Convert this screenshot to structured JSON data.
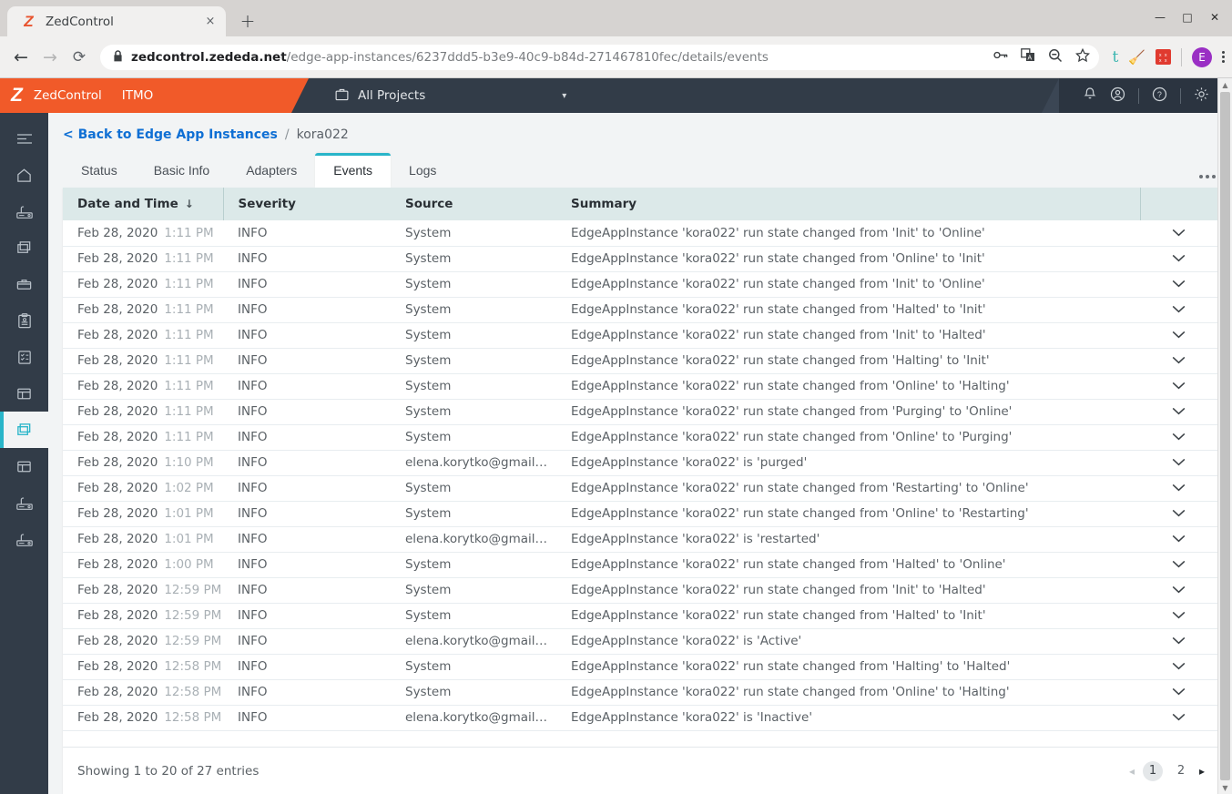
{
  "browser": {
    "tab": {
      "title": "ZedControl",
      "favicon": "zedcontrol-z-icon",
      "close_label": "×"
    },
    "new_tab_label": "+",
    "window_controls": {
      "minimize": "—",
      "maximize": "□",
      "close": "✕"
    },
    "nav": {
      "back": "←",
      "forward": "→",
      "reload": "⟳"
    },
    "url": {
      "lock": "🔒",
      "host": "zedcontrol.zededa.net",
      "path": "/edge-app-instances/6237ddd5-b3e9-40c9-b84d-271467810fec/details/events"
    },
    "omnibox_icons": [
      "key-icon",
      "translate-icon",
      "zoom-out-icon",
      "bookmark-star-icon"
    ],
    "extensions": [
      "tumblr-extension-icon",
      "broom-extension-icon",
      "adblock-extension-icon"
    ],
    "profile_initial": "E",
    "menu": "chrome-menu-icon"
  },
  "appbar": {
    "logo": "Z",
    "product": "ZedControl",
    "org": "ITMO",
    "project_selector": {
      "icon": "briefcase-icon",
      "label": "All Projects",
      "caret": "▾"
    },
    "actions": [
      "notifications-bell-icon",
      "user-account-icon",
      "help-icon",
      "settings-gear-icon"
    ]
  },
  "sidebar": {
    "items": [
      {
        "name": "menu-toggle",
        "icon": "hamburger-icon",
        "active": false
      },
      {
        "name": "home",
        "icon": "home-icon",
        "active": false
      },
      {
        "name": "edge-nodes",
        "icon": "router-icon",
        "active": false
      },
      {
        "name": "edge-apps",
        "icon": "app-stack-icon",
        "active": false
      },
      {
        "name": "volumes",
        "icon": "archive-box-icon",
        "active": false
      },
      {
        "name": "jobs",
        "icon": "clipboard-icon",
        "active": false
      },
      {
        "name": "policies",
        "icon": "checklist-icon",
        "active": false
      },
      {
        "name": "projects",
        "icon": "layout-panel-icon",
        "active": false
      },
      {
        "name": "edge-app-instances",
        "icon": "app-instance-icon",
        "active": true
      },
      {
        "name": "network-instances",
        "icon": "layout-panel-icon",
        "active": false
      },
      {
        "name": "device-models",
        "icon": "router-icon",
        "active": false
      },
      {
        "name": "device-configs",
        "icon": "router-icon",
        "active": false
      }
    ]
  },
  "breadcrumb": {
    "back_label": "< Back to Edge App Instances",
    "separator": "/",
    "current": "kora022"
  },
  "tabs": [
    {
      "label": "Status",
      "active": false
    },
    {
      "label": "Basic Info",
      "active": false
    },
    {
      "label": "Adapters",
      "active": false
    },
    {
      "label": "Events",
      "active": true
    },
    {
      "label": "Logs",
      "active": false
    }
  ],
  "overflow_menu": "more-options-icon",
  "table": {
    "columns": [
      "Date and Time",
      "Severity",
      "Source",
      "Summary",
      ""
    ],
    "sort": {
      "column": "Date and Time",
      "direction": "desc",
      "glyph": "↓"
    },
    "expand_glyph": "ˇ",
    "rows": [
      {
        "date": "Feb 28, 2020",
        "time": "1:11 PM",
        "severity": "INFO",
        "source": "System",
        "summary": "EdgeAppInstance 'kora022' run state changed from 'Init' to 'Online'"
      },
      {
        "date": "Feb 28, 2020",
        "time": "1:11 PM",
        "severity": "INFO",
        "source": "System",
        "summary": "EdgeAppInstance 'kora022' run state changed from 'Online' to 'Init'"
      },
      {
        "date": "Feb 28, 2020",
        "time": "1:11 PM",
        "severity": "INFO",
        "source": "System",
        "summary": "EdgeAppInstance 'kora022' run state changed from 'Init' to 'Online'"
      },
      {
        "date": "Feb 28, 2020",
        "time": "1:11 PM",
        "severity": "INFO",
        "source": "System",
        "summary": "EdgeAppInstance 'kora022' run state changed from 'Halted' to 'Init'"
      },
      {
        "date": "Feb 28, 2020",
        "time": "1:11 PM",
        "severity": "INFO",
        "source": "System",
        "summary": "EdgeAppInstance 'kora022' run state changed from 'Init' to 'Halted'"
      },
      {
        "date": "Feb 28, 2020",
        "time": "1:11 PM",
        "severity": "INFO",
        "source": "System",
        "summary": "EdgeAppInstance 'kora022' run state changed from 'Halting' to 'Init'"
      },
      {
        "date": "Feb 28, 2020",
        "time": "1:11 PM",
        "severity": "INFO",
        "source": "System",
        "summary": "EdgeAppInstance 'kora022' run state changed from 'Online' to 'Halting'"
      },
      {
        "date": "Feb 28, 2020",
        "time": "1:11 PM",
        "severity": "INFO",
        "source": "System",
        "summary": "EdgeAppInstance 'kora022' run state changed from 'Purging' to 'Online'"
      },
      {
        "date": "Feb 28, 2020",
        "time": "1:11 PM",
        "severity": "INFO",
        "source": "System",
        "summary": "EdgeAppInstance 'kora022' run state changed from 'Online' to 'Purging'"
      },
      {
        "date": "Feb 28, 2020",
        "time": "1:10 PM",
        "severity": "INFO",
        "source": "elena.korytko@gmail…",
        "summary": "EdgeAppInstance 'kora022' is 'purged'"
      },
      {
        "date": "Feb 28, 2020",
        "time": "1:02 PM",
        "severity": "INFO",
        "source": "System",
        "summary": "EdgeAppInstance 'kora022' run state changed from 'Restarting' to 'Online'"
      },
      {
        "date": "Feb 28, 2020",
        "time": "1:01 PM",
        "severity": "INFO",
        "source": "System",
        "summary": "EdgeAppInstance 'kora022' run state changed from 'Online' to 'Restarting'"
      },
      {
        "date": "Feb 28, 2020",
        "time": "1:01 PM",
        "severity": "INFO",
        "source": "elena.korytko@gmail…",
        "summary": "EdgeAppInstance 'kora022' is 'restarted'"
      },
      {
        "date": "Feb 28, 2020",
        "time": "1:00 PM",
        "severity": "INFO",
        "source": "System",
        "summary": "EdgeAppInstance 'kora022' run state changed from 'Halted' to 'Online'"
      },
      {
        "date": "Feb 28, 2020",
        "time": "12:59 PM",
        "severity": "INFO",
        "source": "System",
        "summary": "EdgeAppInstance 'kora022' run state changed from 'Init' to 'Halted'"
      },
      {
        "date": "Feb 28, 2020",
        "time": "12:59 PM",
        "severity": "INFO",
        "source": "System",
        "summary": "EdgeAppInstance 'kora022' run state changed from 'Halted' to 'Init'"
      },
      {
        "date": "Feb 28, 2020",
        "time": "12:59 PM",
        "severity": "INFO",
        "source": "elena.korytko@gmail…",
        "summary": "EdgeAppInstance 'kora022' is 'Active'"
      },
      {
        "date": "Feb 28, 2020",
        "time": "12:58 PM",
        "severity": "INFO",
        "source": "System",
        "summary": "EdgeAppInstance 'kora022' run state changed from 'Halting' to 'Halted'"
      },
      {
        "date": "Feb 28, 2020",
        "time": "12:58 PM",
        "severity": "INFO",
        "source": "System",
        "summary": "EdgeAppInstance 'kora022' run state changed from 'Online' to 'Halting'"
      },
      {
        "date": "Feb 28, 2020",
        "time": "12:58 PM",
        "severity": "INFO",
        "source": "elena.korytko@gmail…",
        "summary": "EdgeAppInstance 'kora022' is 'Inactive'"
      }
    ]
  },
  "footer": {
    "showing": "Showing 1 to 20 of 27 entries",
    "prev": "◂",
    "next": "▸",
    "pages": [
      "1",
      "2"
    ],
    "active_page": "1"
  },
  "colors": {
    "brand_orange": "#f15a29",
    "appbar_dark": "#323c48",
    "accent_teal": "#29b5c9",
    "table_header": "#dce9e9",
    "link_blue": "#0f6fd4"
  }
}
